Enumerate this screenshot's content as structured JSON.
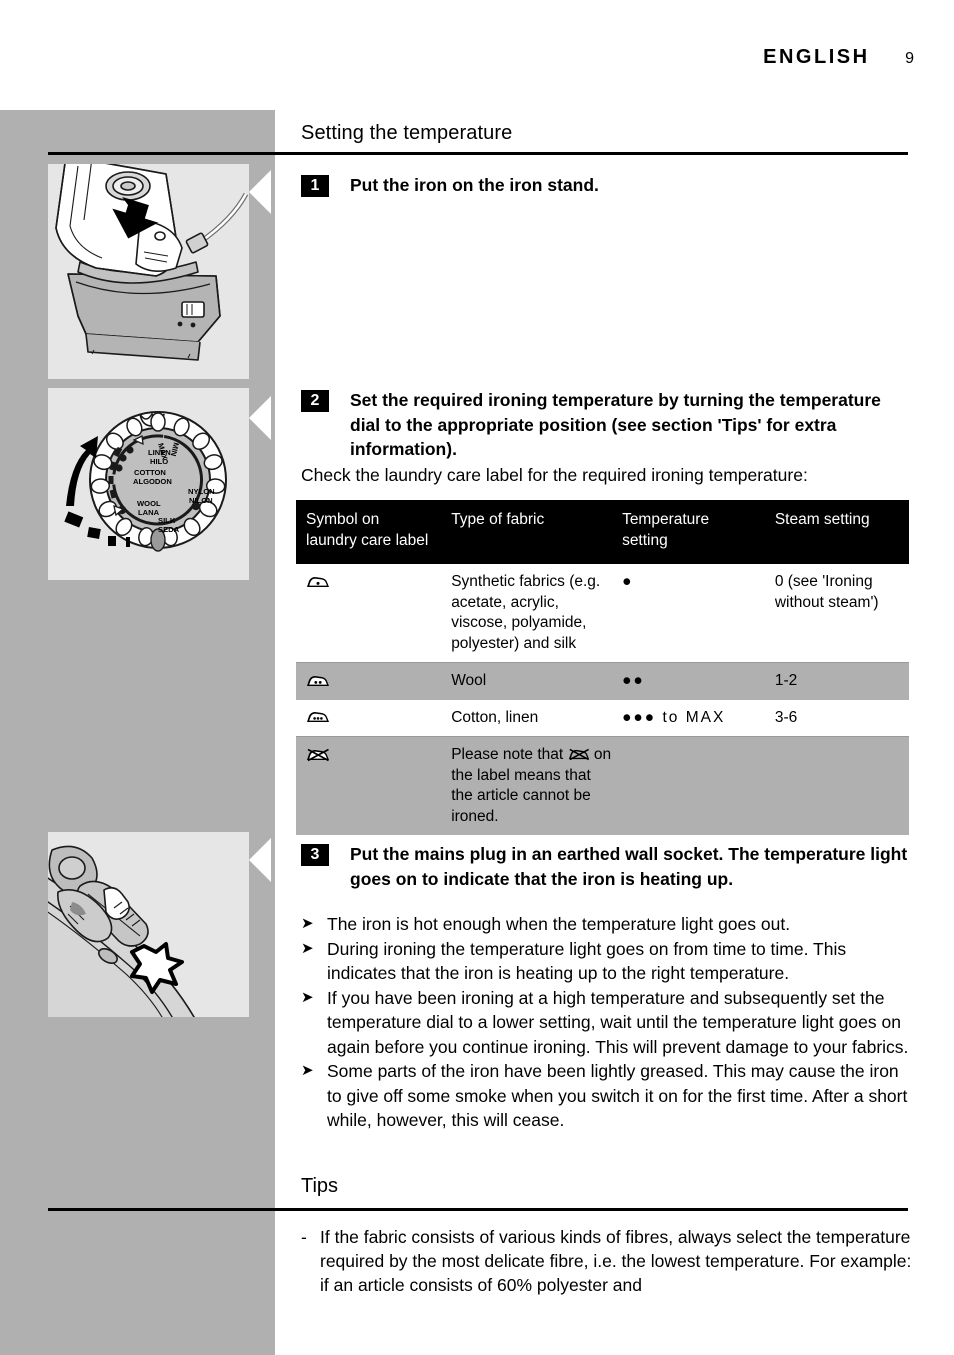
{
  "header": {
    "language": "ENGLISH",
    "page_number": "9"
  },
  "sections": {
    "temperature_title": "Setting the temperature",
    "tips_title": "Tips"
  },
  "steps": [
    {
      "number": "1",
      "text": "Put the iron on the iron stand."
    },
    {
      "number": "2",
      "text": "Set the required ironing temperature by turning the temperature dial to the appropriate position (see section 'Tips' for extra information)."
    },
    {
      "number": "3",
      "text": "Put the mains plug in an earthed wall socket. The temperature light goes on to indicate that the iron is heating up."
    }
  ],
  "check_label_line": "Check the laundry care label for the required ironing temperature:",
  "table": {
    "headers": [
      "Symbol on\nlaundry care label",
      "Type of fabric",
      "Temperature\nsetting",
      "Steam setting"
    ],
    "rows": [
      {
        "symbol": "iron-one-dot",
        "fabric": "Synthetic fabrics (e.g. acetate, acrylic, viscose, polyamide, polyester) and silk",
        "temperature": "●",
        "steam": "0 (see 'Ironing without steam')",
        "shaded": false
      },
      {
        "symbol": "iron-two-dots",
        "fabric": "Wool",
        "temperature": "●●",
        "steam": "1-2",
        "shaded": true
      },
      {
        "symbol": "iron-three-dots",
        "fabric": "Cotton, linen",
        "temperature": "●●● to MAX",
        "steam": "3-6",
        "shaded": false
      },
      {
        "symbol": "iron-crossed-out",
        "fabric_prefix": "Please note that ",
        "fabric_suffix": " on the label means that the article cannot be ironed.",
        "fabric_inline_symbol": "iron-crossed-out",
        "temperature": "",
        "steam": "",
        "shaded": true
      }
    ]
  },
  "bullets": [
    "The iron is hot enough when the temperature light goes out.",
    "During ironing the temperature light goes on from time to time. This indicates that the iron is heating up to the right temperature.",
    "If you have been ironing at a high temperature and subsequently set the temperature dial to a lower setting, wait until the temperature light goes on again before you continue ironing. This will prevent damage to your fabrics.",
    "Some parts of the iron have been lightly greased. This may cause the iron to give off some smoke when you switch it on for the first time. After a short while, however, this will cease."
  ],
  "tips": [
    "If the fabric consists of various kinds of fibres, always select the temperature required by the most delicate fibre, i.e. the lowest temperature. For example: if an article consists of 60% polyester and"
  ],
  "figures": {
    "iron_stand": {
      "name": "iron-on-stand-illustration"
    },
    "temperature_dial": {
      "name": "temperature-dial-illustration",
      "labels": [
        "MAX",
        "LINEN",
        "HILO",
        "COTTON",
        "ALGODON",
        "WOOL",
        "LANA",
        "SILK",
        "SEDA",
        "NYLON",
        "NILON",
        "MIN"
      ]
    },
    "temperature_light": {
      "name": "temperature-light-illustration"
    }
  },
  "colors": {
    "sidebar_gray": "#b0b0b0",
    "figure_bg": "#e6e6e6",
    "table_header_bg": "#000000",
    "table_shaded_bg": "#b0b0b0"
  }
}
